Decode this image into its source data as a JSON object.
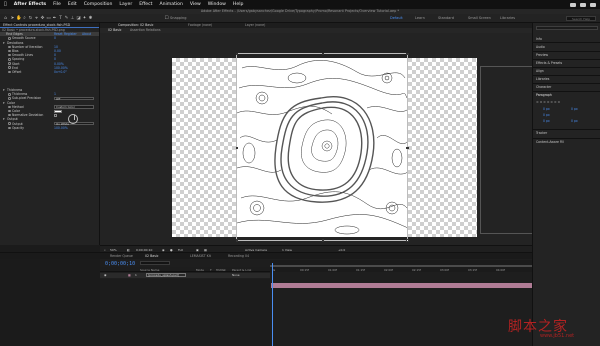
{
  "menubar": {
    "app_name": "After Effects",
    "items": [
      "File",
      "Edit",
      "Composition",
      "Layer",
      "Effect",
      "Animation",
      "View",
      "Window",
      "Help"
    ]
  },
  "titlebar": {
    "title": "Adobe After Effects - /Users/gabysanchez/Google Drive/Typography/Promo/Resonant Projects/Overview Tutorial.aep *"
  },
  "toolbar": {
    "snapping_label": "Snapping",
    "workspaces": [
      "Default",
      "Learn",
      "Standard",
      "Small Screen",
      "Libraries"
    ],
    "active_workspace": "Default",
    "search_help_placeholder": "Search Help"
  },
  "effect_controls": {
    "tab_label": "Effect Controls  procedura_stock-fish.PSD",
    "breadcrumb": "02 Basic • procedura-stock-fish.PSD.png",
    "effect_name": "Find Edges",
    "reset_label": "Reset",
    "register_label": "Register",
    "about_label": "About",
    "rows": [
      {
        "label": "Smooth Source",
        "value": "0",
        "level": 1
      },
      {
        "label": "Deviations",
        "value": "",
        "level": 0
      },
      {
        "label": "Number of Iteration",
        "value": "10",
        "level": 1
      },
      {
        "label": "Bias",
        "value": "0.00",
        "level": 1
      },
      {
        "label": "Smooth Lines",
        "value": "0",
        "level": 1
      },
      {
        "label": "Spacing",
        "value": "0",
        "level": 1
      },
      {
        "label": "Start",
        "value": "0.00%",
        "level": 1
      },
      {
        "label": "End",
        "value": "100.00%",
        "level": 1
      },
      {
        "label": "Offset",
        "value": "0x+0.0°",
        "level": 1
      }
    ],
    "thickness_group": "Thickness",
    "thickness_rows": [
      {
        "label": "Thickness",
        "value": "1"
      },
      {
        "label": "Sub-pixel Precision",
        "value": "Off"
      }
    ],
    "color_group": "Color",
    "color_rows": [
      {
        "label": "Method",
        "value": "Custom Color"
      },
      {
        "label": "Color",
        "value": ""
      },
      {
        "label": "Normalize Deviation",
        "value": ""
      }
    ],
    "output_group": "Output",
    "output_rows": [
      {
        "label": "Output",
        "value": "On White"
      },
      {
        "label": "Opacity",
        "value": "100.00%"
      }
    ]
  },
  "composition": {
    "tabs": [
      "Composition: 02 Basic",
      "Footage (none)",
      "Layer (none)"
    ],
    "subtabs": [
      "02 Basic",
      "Assertion Relations"
    ],
    "zoom": "50%",
    "timecode": "0;00;00;10",
    "resolution": "Full",
    "camera": "Active Camera",
    "views": "1 View",
    "exposure": "+0.0"
  },
  "right_panel": {
    "search_placeholder": "",
    "items": [
      "Info",
      "Audio",
      "Preview",
      "Effects & Presets",
      "Align",
      "Libraries",
      "Character",
      "Paragraph",
      "Tracker",
      "Content-Aware Fill"
    ],
    "paragraph_values": [
      "0 px",
      "0 px",
      "0 px",
      "0 px",
      "0 px"
    ]
  },
  "timeline": {
    "tabs": [
      "Render Queue",
      "02 Basic",
      "LEMASIST Kit",
      "Recording 04"
    ],
    "active_tab": "02 Basic",
    "timecode": "0;00;00;10",
    "columns": [
      "Source Name",
      "Mode",
      "T",
      "TrkMat",
      "Parent & Link"
    ],
    "layer": {
      "index": "1",
      "name": "[procedu_splash.psd]",
      "mode": "None"
    },
    "ruler_ticks": [
      "0s",
      "00:15f",
      "01:00f",
      "01:15f",
      "02:00f",
      "02:15f",
      "03:00f",
      "03:15f",
      "04:00f"
    ]
  },
  "watermark": {
    "main": "脚本之家",
    "sub": "www.jb51.net"
  },
  "colors": {
    "accent": "#4a8ef2",
    "layer_bar": "#b07c95",
    "watermark": "#b22222"
  }
}
